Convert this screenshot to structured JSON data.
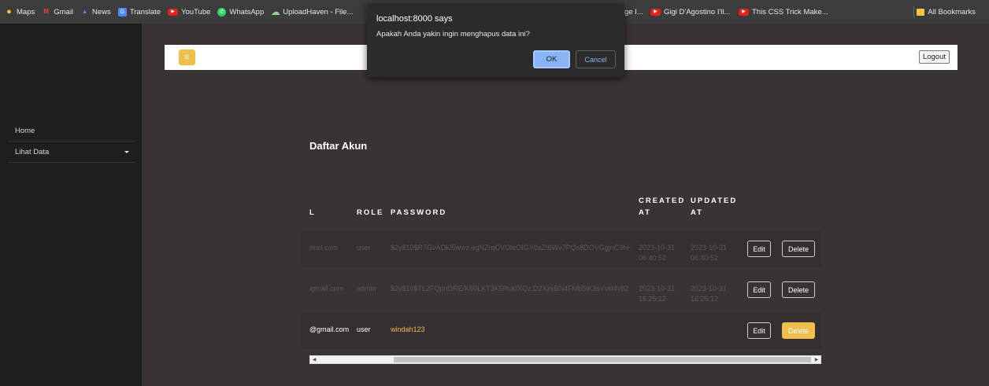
{
  "bookmarks": {
    "items": [
      {
        "label": "Maps",
        "icon": "maps-pin-icon"
      },
      {
        "label": "Gmail",
        "icon": "gmail-icon"
      },
      {
        "label": "News",
        "icon": "news-icon"
      },
      {
        "label": "Translate",
        "icon": "translate-icon"
      },
      {
        "label": "YouTube",
        "icon": "youtube-icon"
      },
      {
        "label": "WhatsApp",
        "icon": "whatsapp-icon"
      },
      {
        "label": "UploadHaven - File...",
        "icon": "cloud-icon"
      }
    ],
    "right_items": [
      {
        "label": "ge I...",
        "icon": ""
      },
      {
        "label": "Gigi D'Agostino I'll...",
        "icon": "youtube-icon"
      },
      {
        "label": "This CSS Trick Make...",
        "icon": "youtube-icon"
      }
    ],
    "all_bookmarks": "All Bookmarks"
  },
  "sidebar": {
    "items": [
      {
        "label": "Home"
      },
      {
        "label": "Lihat Data"
      }
    ]
  },
  "navbar": {
    "menu_icon": "hamburger-icon",
    "logout_label": "Logout"
  },
  "page": {
    "title": "Daftar Akun"
  },
  "table": {
    "headers": {
      "email": "L",
      "role": "ROLE",
      "password": "PASSWORD",
      "created_line1": "CREATED",
      "created_line2": "AT",
      "updated_line1": "UPDATED",
      "updated_line2": "AT"
    },
    "rows": [
      {
        "email": "mail.com",
        "role": "user",
        "password": "$2y$10$R7GvAOkI5wwz.egNZrqCVOleOIGY0aZt6Wv7PQs8DOVGgjnC9hHe",
        "created_date": "2023-10-31",
        "created_time": "06:40:52",
        "updated_date": "2023-10-31",
        "updated_time": "06:40:52",
        "edit_label": "Edit",
        "delete_label": "Delete"
      },
      {
        "email": "igmail.com",
        "role": "admin",
        "password": "$2y$10$TL2FQpnDRE/K80LKT3K5RukIXQz.D2XzkBN4FMb5iK3sVvkl4v82",
        "created_date": "2023-10-31",
        "created_time": "16:25:12",
        "updated_date": "2023-10-31",
        "updated_time": "16:25:12",
        "edit_label": "Edit",
        "delete_label": "Delete"
      },
      {
        "email": "@gmail.com",
        "role": "user",
        "password": "windah123",
        "created_date": "",
        "created_time": "",
        "updated_date": "",
        "updated_time": "",
        "edit_label": "Edit",
        "delete_label": "Delete"
      }
    ]
  },
  "dialog": {
    "title": "localhost:8000 says",
    "message": "Apakah Anda yakin ingin menghapus data ini?",
    "ok_label": "OK",
    "cancel_label": "Cancel"
  },
  "colors": {
    "accent": "#f0be4b",
    "page_bg": "#3a3336",
    "sidebar_bg": "#1e1e1e",
    "dialog_ok": "#8ab4f8"
  }
}
